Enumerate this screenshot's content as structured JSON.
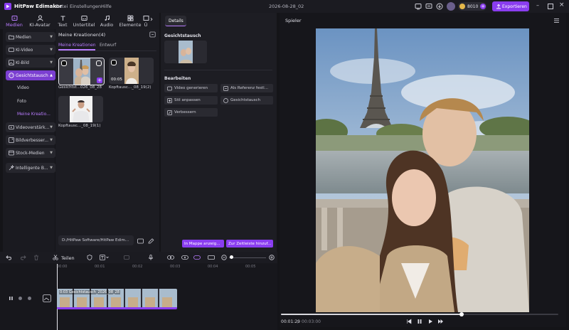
{
  "titlebar": {
    "app_name": "HitPaw Edimakor",
    "menus": [
      "Datei",
      "Einstellungen",
      "Hilfe"
    ],
    "date_title": "2026-08-28_02",
    "credits": "8010",
    "export_label": "Exportieren"
  },
  "tool_tabs": [
    {
      "label": "Medien",
      "icon": "media-icon",
      "active": true
    },
    {
      "label": "KI-Avatar",
      "icon": "ai-avatar-icon",
      "active": false
    },
    {
      "label": "Text",
      "icon": "text-icon",
      "active": false
    },
    {
      "label": "Untertitel",
      "icon": "subtitle-icon",
      "active": false
    },
    {
      "label": "Audio",
      "icon": "audio-icon",
      "active": false
    },
    {
      "label": "Elemente",
      "icon": "elements-icon",
      "active": false
    },
    {
      "label": "Ü",
      "icon": "transition-icon",
      "active": false
    }
  ],
  "sidebar": {
    "categories": [
      {
        "label": "Medien",
        "icon": "folder-icon"
      },
      {
        "label": "KI-Video",
        "icon": "ai-video-icon"
      },
      {
        "label": "KI-Bild",
        "icon": "ai-image-icon"
      },
      {
        "label": "Gesichtstausch",
        "icon": "face-swap-icon",
        "active": true
      },
      {
        "label": "Videoverstärk...",
        "icon": "video-enhance-icon"
      },
      {
        "label": "Bildverbesser...",
        "icon": "image-enhance-icon"
      },
      {
        "label": "Stock-Medien",
        "icon": "stock-media-icon"
      },
      {
        "label": "Intelligente B...",
        "icon": "smart-tools-icon"
      }
    ],
    "sub_items": [
      {
        "label": "Video",
        "active": false
      },
      {
        "label": "Foto",
        "active": false
      },
      {
        "label": "Meine Kreatio...",
        "active": true
      }
    ]
  },
  "media": {
    "title": "Meine Kreationen(4)",
    "tabs": [
      {
        "label": "Meine Kreationen",
        "active": true
      },
      {
        "label": "Entwurf",
        "active": false
      }
    ],
    "items": [
      {
        "caption": "Gesichtst...026_08_28",
        "duration": ""
      },
      {
        "caption": "Kopftausc..._08_19(2)",
        "duration": "00:05"
      },
      {
        "caption": "Kopftausc..._08_19(1)",
        "duration": ""
      }
    ],
    "path": "D:/HitPaw Software/HitPaw Edim..."
  },
  "details": {
    "tab_label": "Details",
    "face_swap_heading": "Gesichtstausch",
    "edit_heading": "Bearbeiten",
    "edit_buttons": [
      {
        "label": "Video generieren",
        "icon": "video-generate-icon"
      },
      {
        "label": "Als Referenz festl...",
        "icon": "reference-icon"
      },
      {
        "label": "Stil anpassen",
        "icon": "style-icon"
      },
      {
        "label": "Gesichtstausch",
        "icon": "face-swap-icon"
      },
      {
        "label": "Verbessern",
        "icon": "enhance-icon"
      }
    ],
    "folder_button": "In Mappe anzeig...",
    "timeline_button": "Zur Zeitleiste hinzuf..."
  },
  "player": {
    "title": "Spieler",
    "current_time": "00:01:29",
    "total_time": "00:03:00",
    "progress": 0.65
  },
  "timeline": {
    "split_label": "Teilen",
    "ruler_labels": [
      "00:00",
      "00:01",
      "00:02",
      "00:03",
      "00:04",
      "00:05"
    ],
    "clip_label": "0:03 Gesichtstausch_2026_08_28"
  },
  "colors": {
    "accent": "#8a3df0",
    "accent_light": "#b97cff",
    "background": "#141418"
  }
}
